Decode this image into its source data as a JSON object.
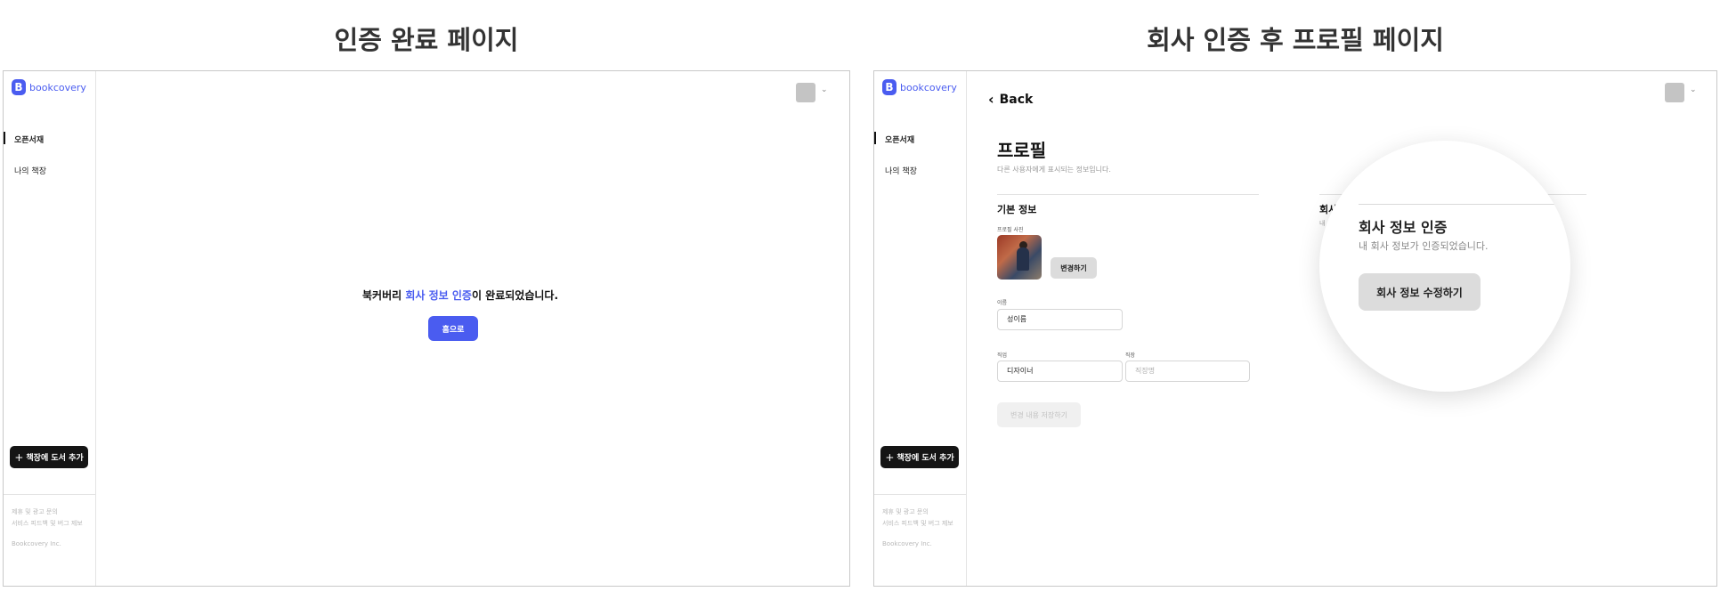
{
  "captions": {
    "left": "인증 완료 페이지",
    "right": "회사 인증 후 프로필 페이지"
  },
  "brand": {
    "name": "bookcovery",
    "mark": "B",
    "color": "#4a5cf0"
  },
  "sidebar": {
    "items": [
      {
        "label": "오픈서재",
        "active": true
      },
      {
        "label": "나의 책장",
        "active": false
      }
    ],
    "add_button_label": "책장에 도서 추가",
    "footer_links": [
      "제휴 및 광고 문의",
      "서비스 피드백 및 버그 제보"
    ],
    "company": "Bookcovery Inc."
  },
  "done_page": {
    "message_prefix": "북커버리 ",
    "message_highlight": "회사 정보 인증",
    "message_suffix": "이 완료되었습니다.",
    "home_button_label": "홈으로"
  },
  "profile_page": {
    "back_label": "Back",
    "title": "프로필",
    "subtitle": "다른 사용자에게 표시되는 정보입니다.",
    "basic_info_title": "기본 정보",
    "photo_label": "프로필 사진",
    "change_button_label": "변경하기",
    "name_label": "이름",
    "name_value": "성이름",
    "job_label": "직업",
    "job_value": "디자이너",
    "position_label": "직장",
    "position_placeholder": "직장명",
    "save_button_label": "변경 내용 저장하기",
    "behind_title_fragment": "회사",
    "behind_sub_fragment": "내",
    "company_verify": {
      "title": "회사 정보 인증",
      "status": "내 회사 정보가 인증되었습니다.",
      "edit_button_label": "회사 정보 수정하기"
    }
  },
  "icons": {
    "chevron": "chevron-down-icon",
    "back": "chevron-left-icon",
    "plus": "plus-icon"
  }
}
